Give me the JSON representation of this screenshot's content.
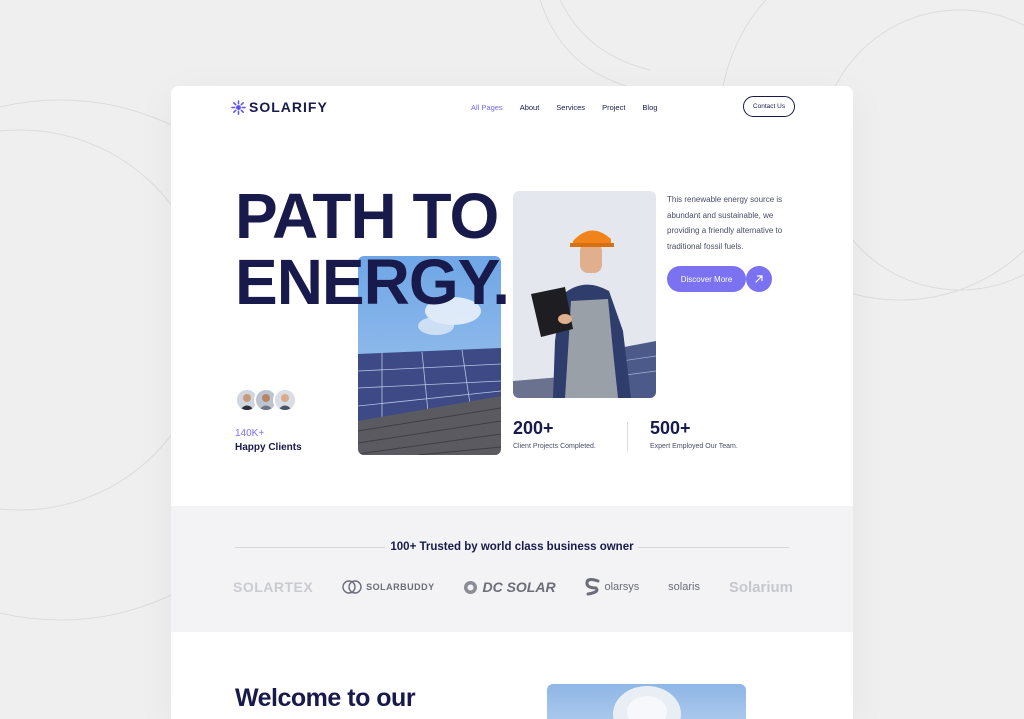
{
  "brand": {
    "name": "SOLARIFY"
  },
  "nav": {
    "items": [
      {
        "label": "All Pages",
        "active": true
      },
      {
        "label": "About",
        "active": false
      },
      {
        "label": "Services",
        "active": false
      },
      {
        "label": "Project",
        "active": false
      },
      {
        "label": "Blog",
        "active": false
      }
    ],
    "contact_label": "Contact Us"
  },
  "hero": {
    "title_line1": "PATH TO",
    "title_line2": "ENERGY.",
    "description": "This renewable energy source is abundant and sustainable, we providing a friendly alternative to traditional fossil fuels.",
    "cta_label": "Discover More",
    "clients_count": "140K+",
    "clients_label": "Happy Clients",
    "stats": [
      {
        "value": "200+",
        "label": "Client Projects Completed."
      },
      {
        "value": "500+",
        "label": "Expert Employed Our Team."
      }
    ]
  },
  "trusted": {
    "title": "100+ Trusted by world class business owner",
    "logos": [
      "SOLARTEX",
      "SOLARBUDDY",
      "DC SOLAR",
      "olarsys",
      "solaris",
      "Solarium"
    ]
  },
  "welcome": {
    "heading": "Welcome to our"
  },
  "colors": {
    "accent": "#7b72f2",
    "navy": "#171a4a",
    "band": "#f3f3f5"
  },
  "icons": [
    "sun-logo-icon",
    "arrow-up-right-icon"
  ]
}
